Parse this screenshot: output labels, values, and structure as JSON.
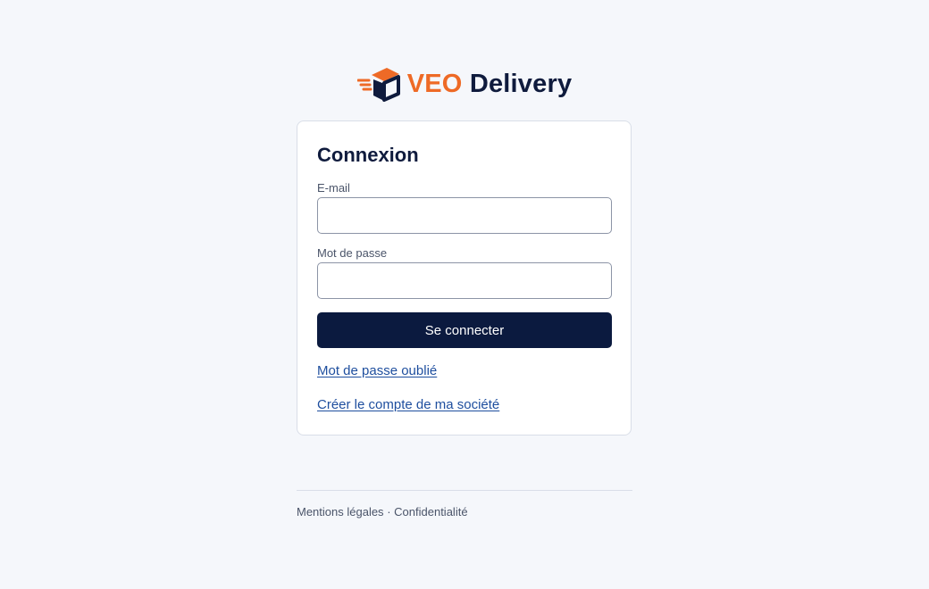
{
  "brand": {
    "name_part1": "VEO",
    "name_part2": "Delivery",
    "accent_color": "#ee6a26",
    "navy_color": "#0f1b3d"
  },
  "login": {
    "title": "Connexion",
    "email_label": "E-mail",
    "email_value": "",
    "email_placeholder": "",
    "password_label": "Mot de passe",
    "password_value": "",
    "password_placeholder": "",
    "submit_label": "Se connecter",
    "forgot_password_link": "Mot de passe oublié",
    "create_account_link": "Créer le compte de ma société"
  },
  "footer": {
    "legal_link": "Mentions légales",
    "separator": "·",
    "privacy_link": "Confidentialité"
  }
}
